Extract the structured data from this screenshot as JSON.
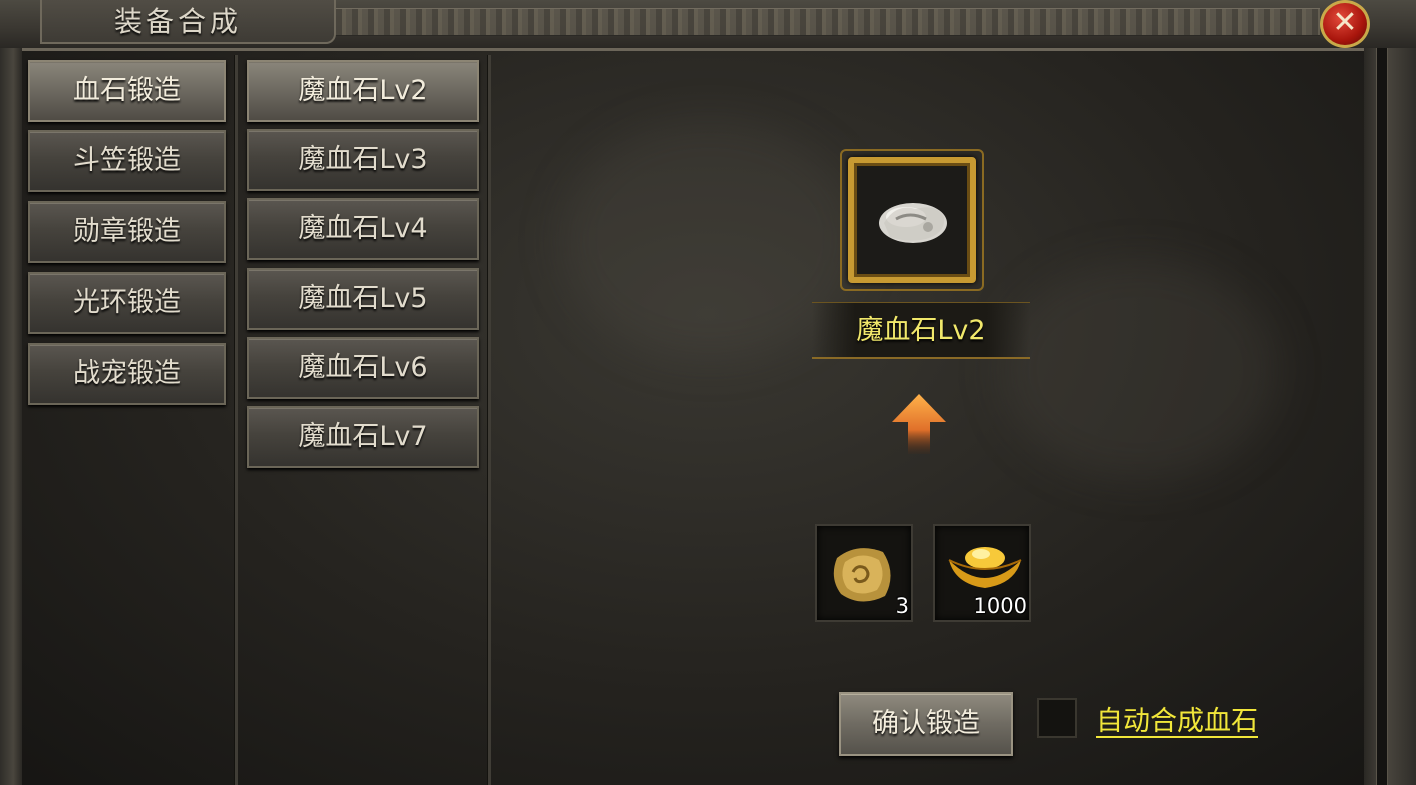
{
  "window": {
    "title": "装备合成",
    "close_icon": "close-x-icon"
  },
  "categories": [
    {
      "label": "血石锻造",
      "active": true
    },
    {
      "label": "斗笠锻造",
      "active": false
    },
    {
      "label": "勋章锻造",
      "active": false
    },
    {
      "label": "光环锻造",
      "active": false
    },
    {
      "label": "战宠锻造",
      "active": false
    }
  ],
  "items": [
    {
      "label": "魔血石Lv2",
      "active": true
    },
    {
      "label": "魔血石Lv3",
      "active": false
    },
    {
      "label": "魔血石Lv4",
      "active": false
    },
    {
      "label": "魔血石Lv5",
      "active": false
    },
    {
      "label": "魔血石Lv6",
      "active": false
    },
    {
      "label": "魔血石Lv7",
      "active": false
    }
  ],
  "result": {
    "name": "魔血石Lv2",
    "icon": "blood-stone-icon"
  },
  "materials": [
    {
      "icon": "ore-stone-icon",
      "count": "3"
    },
    {
      "icon": "gold-ingot-icon",
      "count": "1000"
    }
  ],
  "actions": {
    "confirm_label": "确认锻造",
    "auto_label": "自动合成血石",
    "auto_checked": false
  },
  "colors": {
    "name_yellow": "#f1e86b",
    "link_yellow": "#f1e63a",
    "frame_gold": "#c79a32",
    "close_red": "#a8150c"
  }
}
